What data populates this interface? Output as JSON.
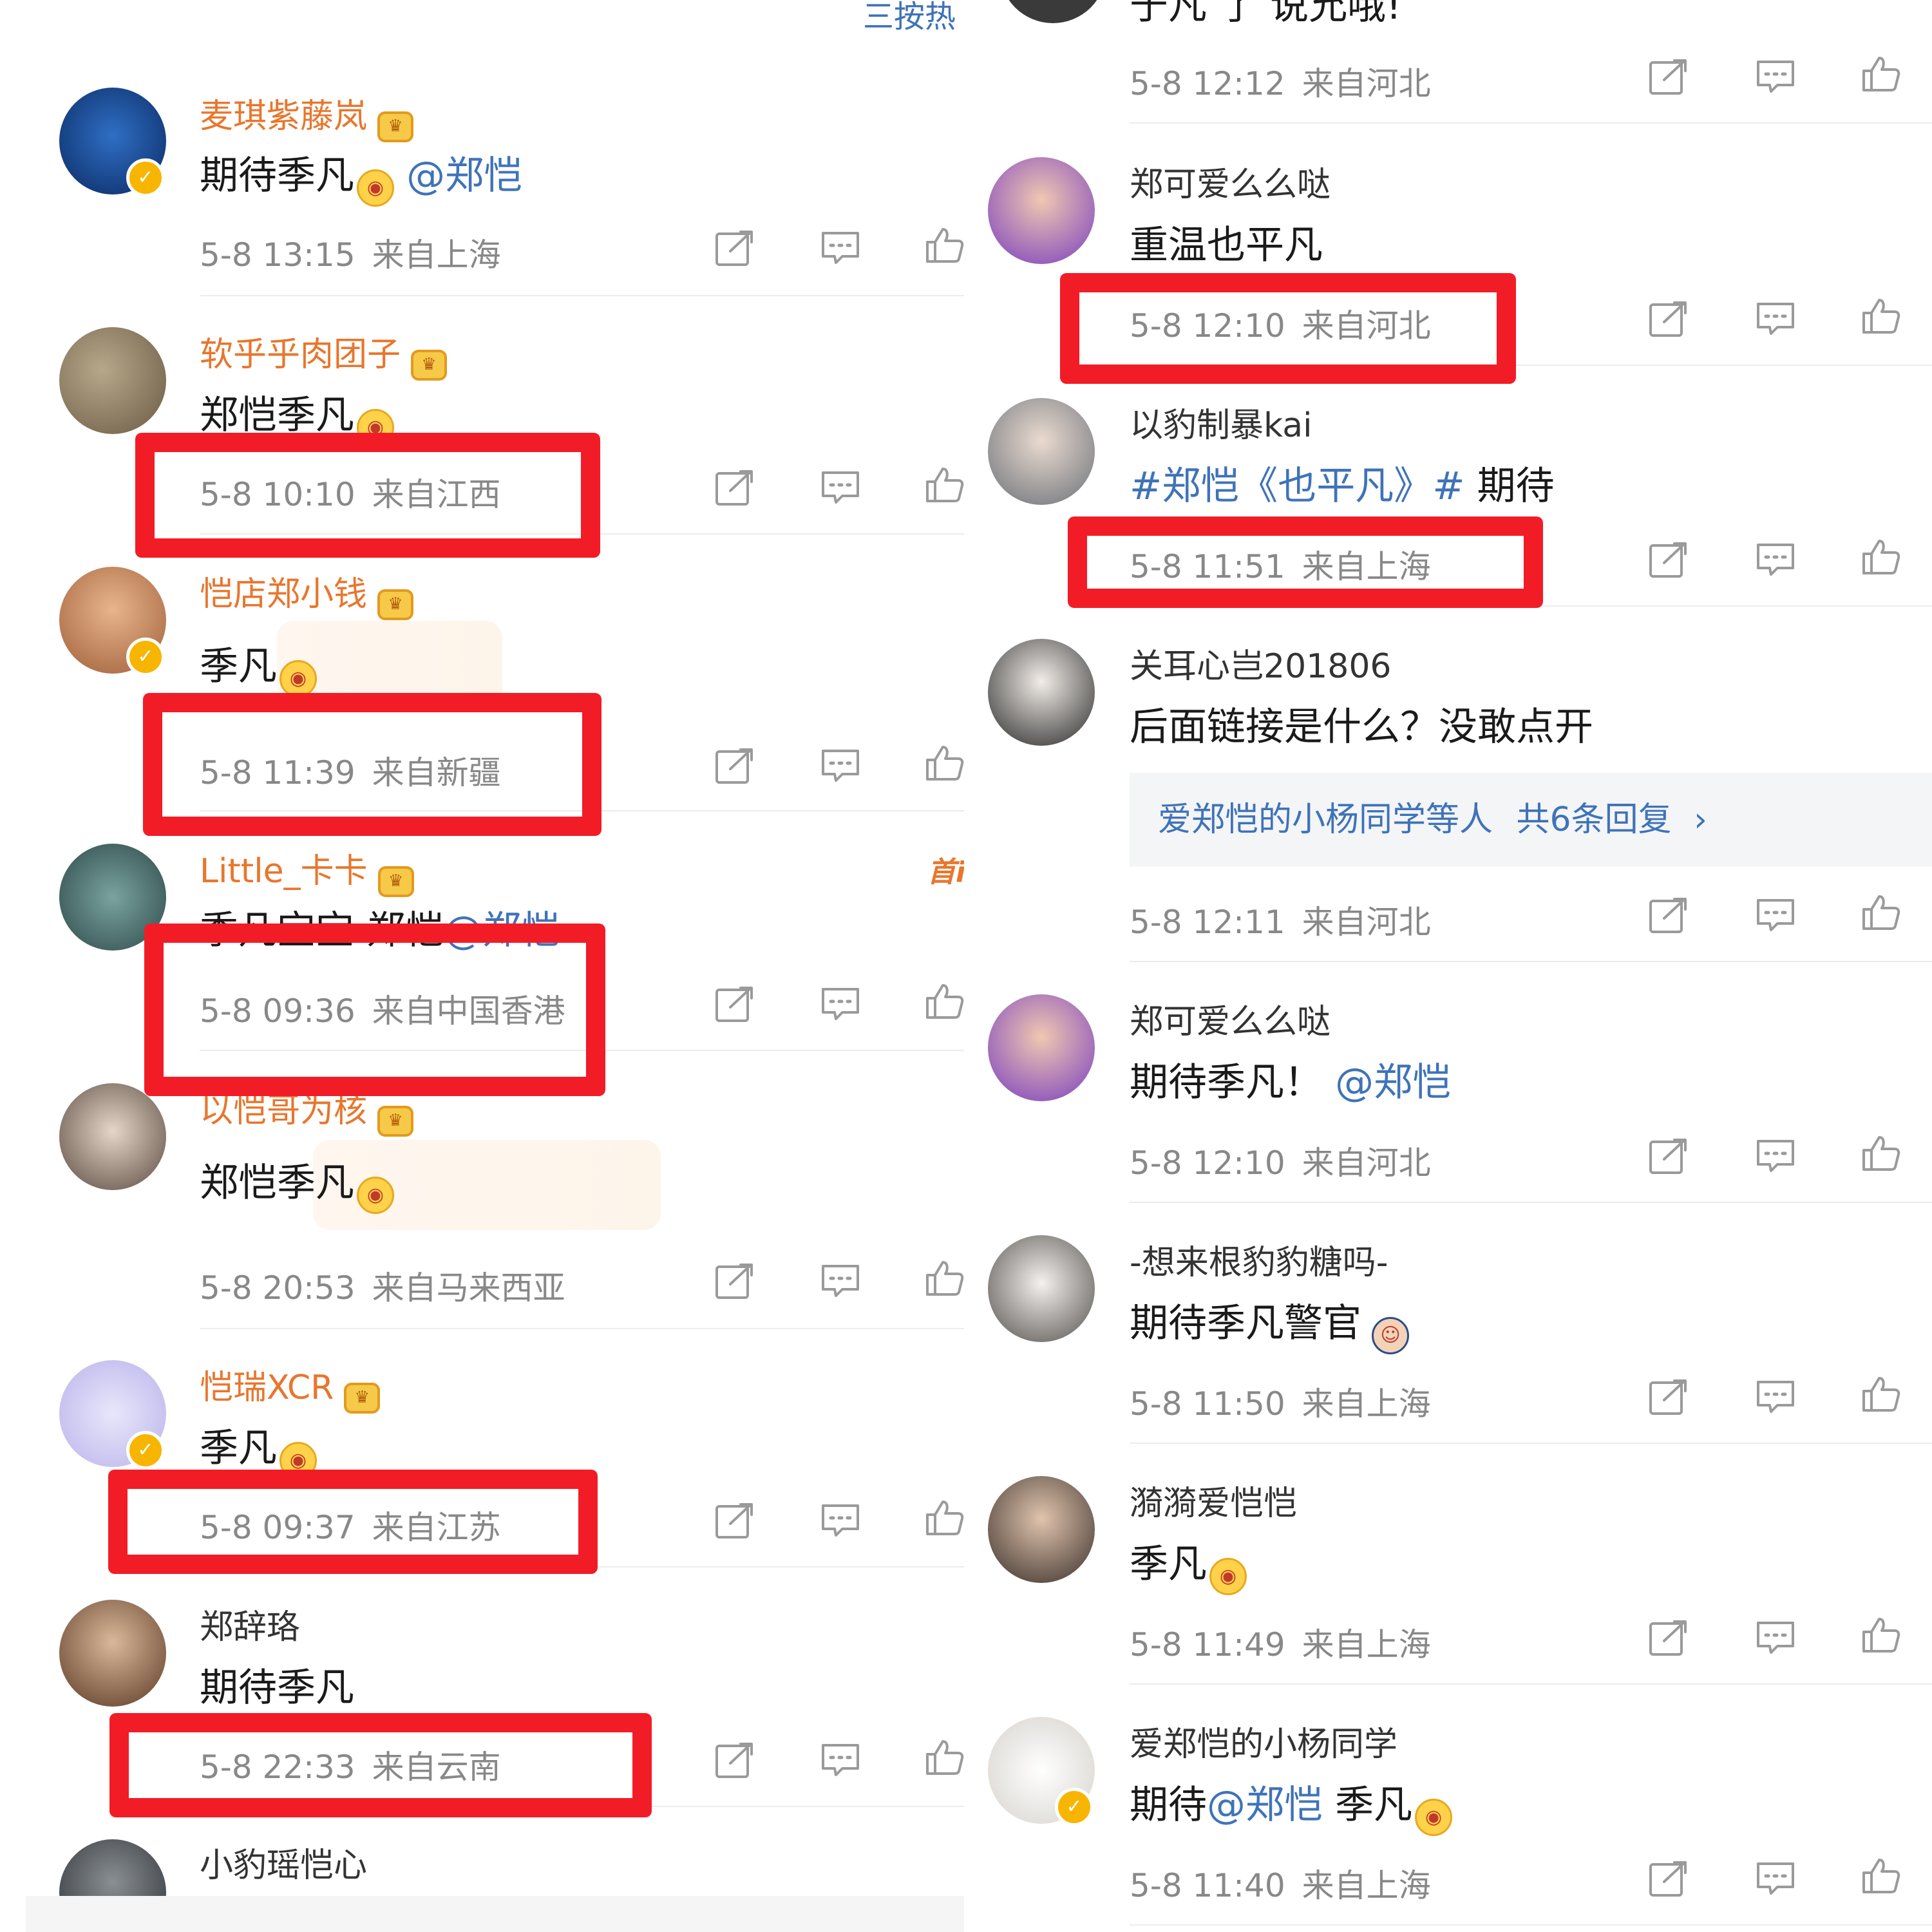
{
  "left": {
    "sort_label": "三按热",
    "first_tag": "首i",
    "comments": [
      {
        "user": "麦琪紫藤岚",
        "text": "期待季凡",
        "mention": "@郑恺",
        "time": "5-8 13:15",
        "loc": "来自上海"
      },
      {
        "user": "软乎乎肉团子",
        "text": "郑恺季凡",
        "time": "5-8 10:10",
        "loc": "来自江西"
      },
      {
        "user": "恺店郑小钱",
        "text": "季凡",
        "time": "5-8 11:39",
        "loc": "来自新疆"
      },
      {
        "user": "Little_卡卡",
        "text": "季凡宝宝 郑恺",
        "mention": "@郑恺",
        "time": "5-8 09:36",
        "loc": "来自中国香港"
      },
      {
        "user": "以恺哥为核",
        "text": "郑恺季凡",
        "time": "5-8 20:53",
        "loc": "来自马来西亚"
      },
      {
        "user": "恺瑞XCR",
        "text": "季凡",
        "time": "5-8 09:37",
        "loc": "来自江苏"
      },
      {
        "user": "郑辞珞",
        "text": "期待季凡",
        "time": "5-8 22:33",
        "loc": "来自云南"
      },
      {
        "user": "小豹瑶恺心"
      }
    ]
  },
  "right": {
    "top_partial_text": "于凡 了 说允哦!",
    "comments": [
      {
        "time": "5-8 12:12",
        "loc": "来自河北"
      },
      {
        "user": "郑可爱么么哒",
        "text": "重温也平凡",
        "time": "5-8 12:10",
        "loc": "来自河北"
      },
      {
        "user": "以豹制暴kai",
        "topic": "#郑恺《也平凡》#",
        "text": " 期待",
        "time": "5-8 11:51",
        "loc": "来自上海"
      },
      {
        "user": "关耳心岂201806",
        "text": "后面链接是什么？没敢点开",
        "reply_users": "爱郑恺的小杨同学等人",
        "reply_count": "共6条回复",
        "reply_arrow": "›",
        "time": "5-8 12:11",
        "loc": "来自河北"
      },
      {
        "user": "郑可爱么么哒",
        "text": "期待季凡！",
        "mention": "@郑恺",
        "time": "5-8 12:10",
        "loc": "来自河北"
      },
      {
        "user": "-想来根豹豹糖吗-",
        "text": "期待季凡警官",
        "time": "5-8 11:50",
        "loc": "来自上海"
      },
      {
        "user": "漪漪爱恺恺",
        "text": "季凡",
        "time": "5-8 11:49",
        "loc": "来自上海"
      },
      {
        "user": "爱郑恺的小杨同学",
        "text_pre": "期待",
        "mention": "@郑恺",
        "text": " 季凡",
        "time": "5-8 11:40",
        "loc": "来自上海"
      }
    ]
  },
  "colors": {
    "vip_name": "#e8762d",
    "link": "#3f73b8",
    "meta": "#888888",
    "highlight": "#f21c27"
  },
  "icons": [
    "share-icon",
    "comment-icon",
    "like-icon",
    "crown-badge-icon",
    "verified-icon"
  ]
}
